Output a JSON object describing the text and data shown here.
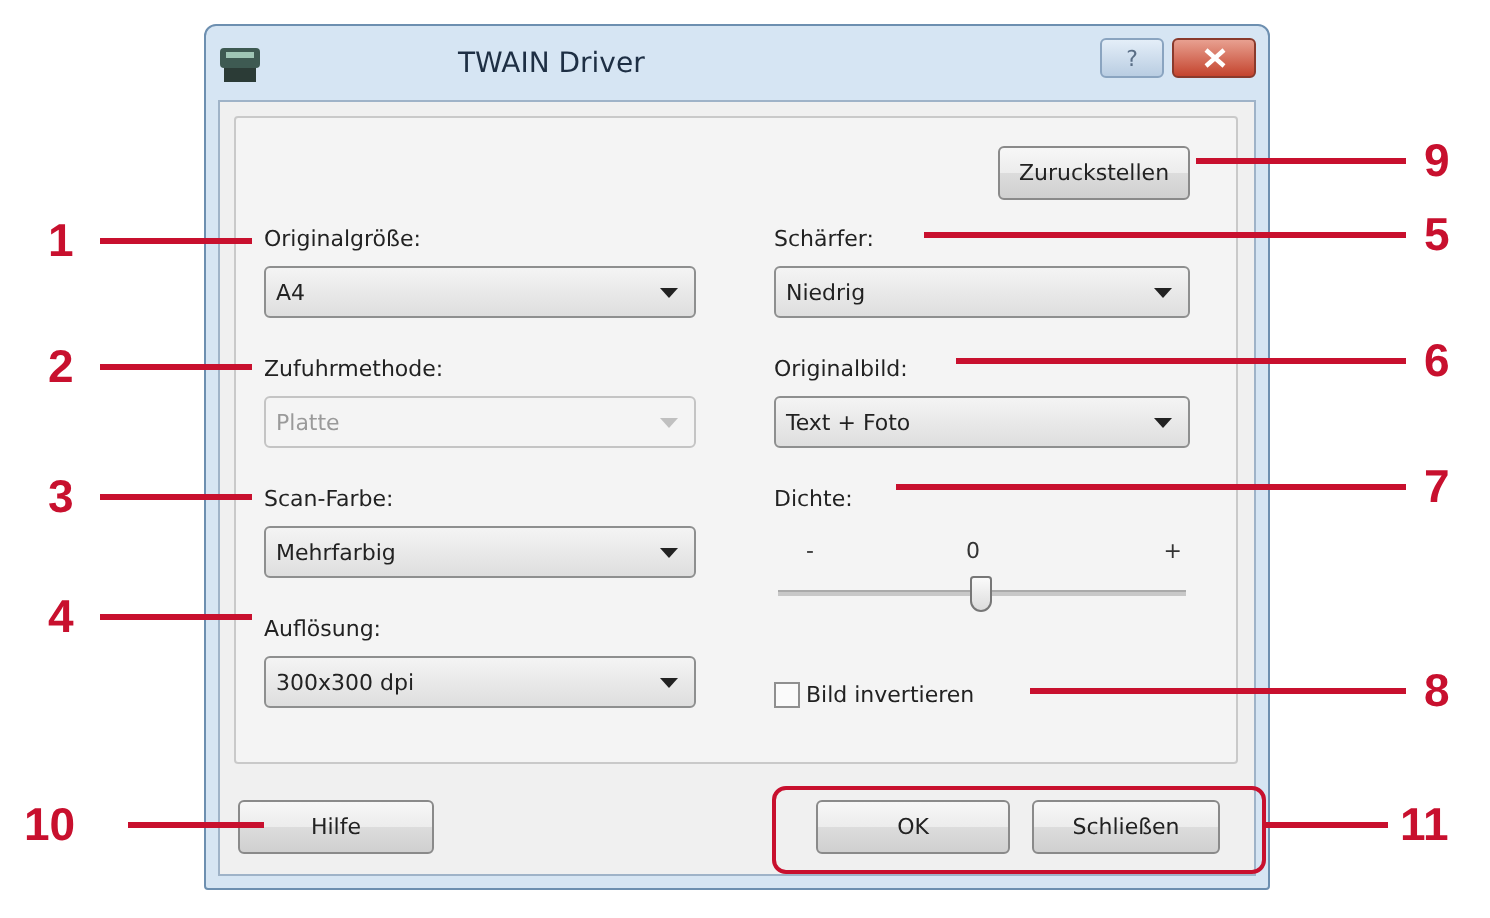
{
  "window": {
    "title": "TWAIN Driver",
    "help_glyph": "?"
  },
  "reset_button": "Zuruckstellen",
  "left_fields": [
    {
      "label": "Originalgröße:",
      "value": "A4",
      "disabled": false
    },
    {
      "label": "Zufuhrmethode:",
      "value": "Platte",
      "disabled": true
    },
    {
      "label": "Scan-Farbe:",
      "value": "Mehrfarbig",
      "disabled": false
    },
    {
      "label": "Auflösung:",
      "value": "300x300 dpi",
      "disabled": false
    }
  ],
  "right_fields": [
    {
      "label": "Schärfer:",
      "value": "Niedrig",
      "disabled": false
    },
    {
      "label": "Originalbild:",
      "value": "Text + Foto",
      "disabled": false
    }
  ],
  "density": {
    "label": "Dichte:",
    "min_label": "-",
    "max_label": "+",
    "reading": "0",
    "level": 0.5
  },
  "invert": {
    "label": "Bild invertieren",
    "checked": false
  },
  "buttons": {
    "help": "Hilfe",
    "ok": "OK",
    "close": "Schließen"
  },
  "callouts": [
    {
      "number": "9"
    },
    {
      "number": "1"
    },
    {
      "number": "5"
    },
    {
      "number": "2"
    },
    {
      "number": "6"
    },
    {
      "number": "3"
    },
    {
      "number": "7"
    },
    {
      "number": "4"
    },
    {
      "number": "8"
    },
    {
      "number": "10"
    },
    {
      "number": "11"
    }
  ]
}
